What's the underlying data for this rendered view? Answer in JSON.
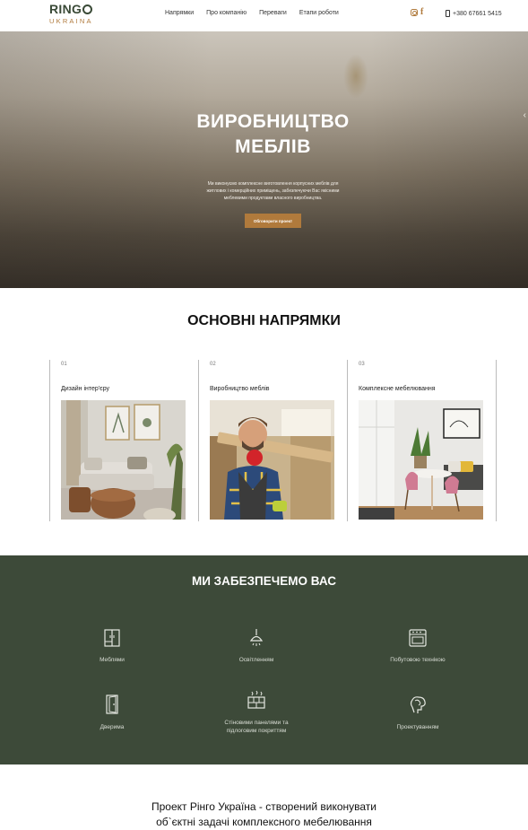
{
  "header": {
    "logo_main": "RING",
    "logo_sub": "UKRAINA",
    "nav": [
      "Напрямки",
      "Про компанію",
      "Переваги",
      "Етапи роботи"
    ],
    "phone": "+380 67661 5415"
  },
  "hero": {
    "title_line1": "ВИРОБНИЦТВО",
    "title_line2": "МЕБЛІВ",
    "text": "Ми виконуємо комплексне виготовлення корпусних меблів для житлових і комерційних приміщень, забезпечуючи Вас якісними меблевими продуктами власного виробництва.",
    "button_label": "Обговорити проект",
    "arrow": "‹"
  },
  "directions": {
    "title": "ОСНОВНІ НАПРЯМКИ",
    "cards": [
      {
        "num": "01",
        "label": "Дизайн інтер'єру"
      },
      {
        "num": "02",
        "label": "Виробництво меблів"
      },
      {
        "num": "03",
        "label": "Комплексне мебелювання"
      }
    ]
  },
  "provide": {
    "title": "МИ ЗАБЕЗПЕЧЕМО ВАС",
    "items": [
      {
        "label": "Меблями",
        "icon": "wardrobe-icon"
      },
      {
        "label": "Освітленням",
        "icon": "lamp-icon"
      },
      {
        "label": "Побутовою технікою",
        "icon": "stove-icon"
      },
      {
        "label": "Дверима",
        "icon": "door-icon"
      },
      {
        "label_line1": "Стіновими панелями та",
        "label_line2": "підлоговим покриттям",
        "icon": "panels-icon"
      },
      {
        "label": "Проектуванням",
        "icon": "design-brain-icon"
      }
    ]
  },
  "about": {
    "line1": "Проект Рінго Україна - створений виконувати",
    "line2": "об`єктні задачі комплексного мебелювання"
  },
  "colors": {
    "accent": "#b07a3c",
    "dark_green": "#3d4a39"
  }
}
